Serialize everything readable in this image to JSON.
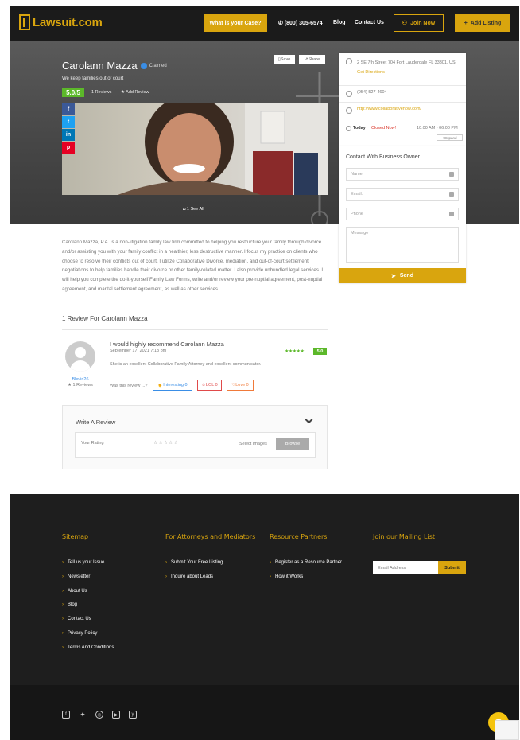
{
  "brand": {
    "logo_text": "Lawsuit.com",
    "accent": "#d9a50e"
  },
  "nav": {
    "case_label": "What is your Case?",
    "phone": "(800) 305-6574",
    "blog": "Blog",
    "contact": "Contact Us",
    "join": "Join Now",
    "add_listing": "Add Listing"
  },
  "listing": {
    "name": "Carolann Mazza",
    "claimed": "Claimed",
    "tagline": "We keep families out of court",
    "rating": "5.0/5",
    "reviews_count": "1 Reviews",
    "add_review": "Add Review",
    "save": "Save",
    "share": "Share",
    "see_all": "1 See All",
    "social": [
      "f",
      "t",
      "in",
      "p"
    ]
  },
  "info": {
    "address": "2 SE 7th Street 704 Fort Lauderdale FL 33301, US",
    "directions": "Get Directions",
    "phone": "(954) 527-4604",
    "website": "http://www.collaborativenow.com/",
    "today": "Today",
    "status": "Closed Now!",
    "hours": "10:00 AM - 06:00 PM",
    "expand": "Expand"
  },
  "contact_form": {
    "title": "Contact With Business Owner",
    "name_ph": "Name:",
    "email_ph": "Email:",
    "phone_ph": "Phone",
    "message_ph": "Message",
    "send": "Send"
  },
  "description": "Carolann Mazza, P.A. is a non-litigation family law firm committed to helping you restructure your family through divorce and/or assisting you with your family conflict in a healthier, less destructive manner. I focus my practice on clients who choose to resolve their conflicts out of court. I utilize Collaborative Divorce, mediation, and out-of-court settlement negotiations to help families handle their divorce or other family-related matter. I also provide unbundled legal services. I will help you complete the do-it-yourself Family Law Forms, write and/or review your pre-nuptial agreement, post-nuptial agreement, and marital settlement agreement, as well as other services.",
  "reviews": {
    "heading": "1 Review For Carolann Mazza",
    "items": [
      {
        "title": "I would highly recommend Carolann Mazza",
        "date": "September 17, 2021 7:13 pm",
        "stars": "★★★★★",
        "score": "5.0",
        "body": "She is an excellent Collaborative Family Attorney and excellent communicator.",
        "reviewer": "Blevin26",
        "reviewer_count": "1 Reviews",
        "helpful": "Was this review ...?",
        "interesting": "Interesting 0",
        "lol": "LOL 0",
        "love": "Love 0"
      }
    ]
  },
  "write_review": {
    "title": "Write A Review",
    "your_rating": "Your Rating",
    "stars": "☆☆☆☆☆",
    "select_images": "Select Images",
    "browse": "Browse"
  },
  "footer": {
    "sitemap": {
      "heading": "Sitemap",
      "items": [
        "Tell us your Issue",
        "Newsletter",
        "About Us",
        "Blog",
        "Contact Us",
        "Privacy Policy",
        "Terms And Conditions"
      ]
    },
    "attorneys": {
      "heading": "For Attorneys and Mediators",
      "items": [
        "Submit Your Free Listing",
        "Inquire about Leads"
      ]
    },
    "resources": {
      "heading": "Resource Partners",
      "items": [
        "Register as a Resource Partner",
        "How it Works"
      ]
    },
    "mailing": {
      "heading": "Join our Mailing List",
      "placeholder": "Email Address",
      "submit": "Submit"
    }
  }
}
